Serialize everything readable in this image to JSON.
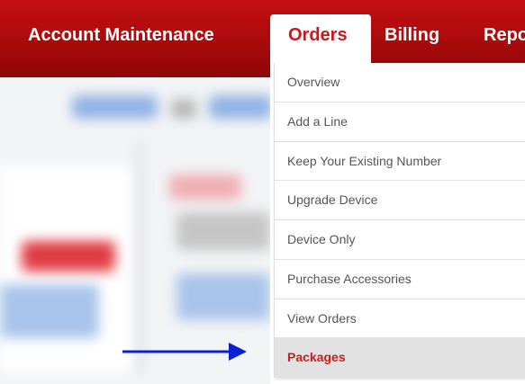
{
  "nav": {
    "items": [
      {
        "label": "Account Maintenance"
      },
      {
        "label": "Orders"
      },
      {
        "label": "Billing"
      },
      {
        "label": "Repo"
      }
    ],
    "active_index": 1
  },
  "orders_menu": {
    "items": [
      {
        "label": "Overview"
      },
      {
        "label": "Add a Line"
      },
      {
        "label": "Keep Your Existing Number"
      },
      {
        "label": "Upgrade Device"
      },
      {
        "label": "Device Only"
      },
      {
        "label": "Purchase Accessories"
      },
      {
        "label": "View Orders"
      },
      {
        "label": "Packages"
      }
    ],
    "highlighted_index": 7
  },
  "colors": {
    "nav_red": "#b80b0e",
    "active_text_red": "#d0161b",
    "arrow_blue": "#0b1fd6",
    "menu_highlight": "#e2e2e2"
  },
  "icons": {
    "pointer": "right-arrow-icon"
  }
}
